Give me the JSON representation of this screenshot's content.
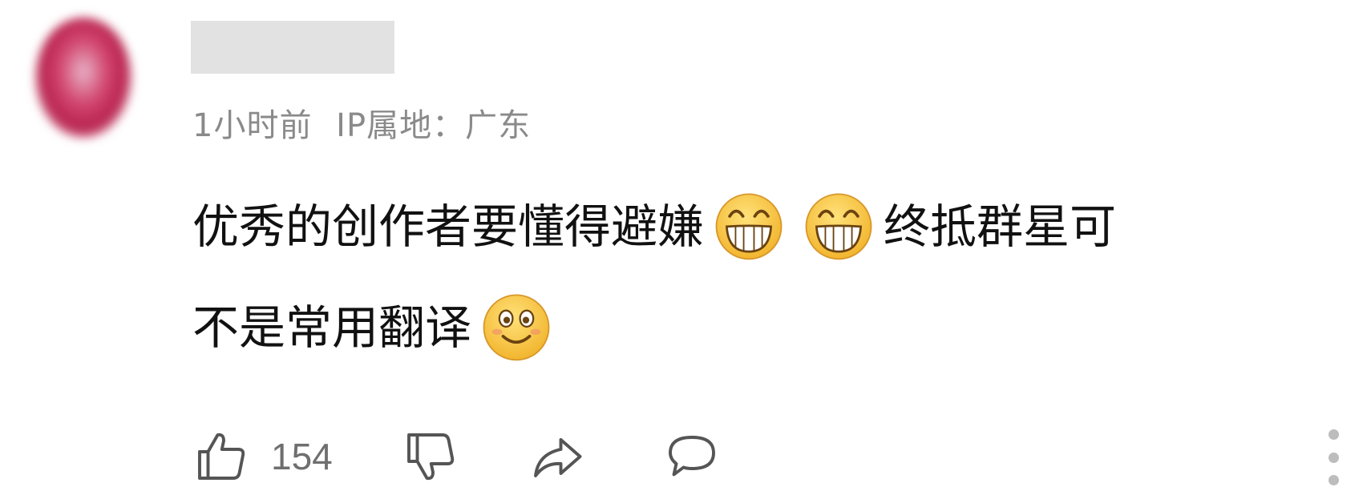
{
  "comment": {
    "meta": {
      "time": "1小时前",
      "ip_location": "IP属地：广东"
    },
    "content": {
      "line1_text_a": "优秀的创作者要懂得避嫌",
      "line1_emoji_1": "grin-emoji",
      "line1_emoji_2": "grin-emoji",
      "line1_text_b": "终抵群星可",
      "line2_text": "不是常用翻译",
      "line2_emoji": "smile-emoji"
    },
    "actions": {
      "like_count": "154",
      "like_icon": "thumbs-up-icon",
      "dislike_icon": "thumbs-down-icon",
      "share_icon": "share-icon",
      "reply_icon": "comment-icon",
      "more_icon": "more-vertical-icon"
    },
    "colors": {
      "meta_text": "#8a8a8a",
      "content_text": "#111111",
      "icon_stroke": "#555555",
      "emoji_face": "#f7c948",
      "redacted_block": "#e2e2e2"
    }
  }
}
